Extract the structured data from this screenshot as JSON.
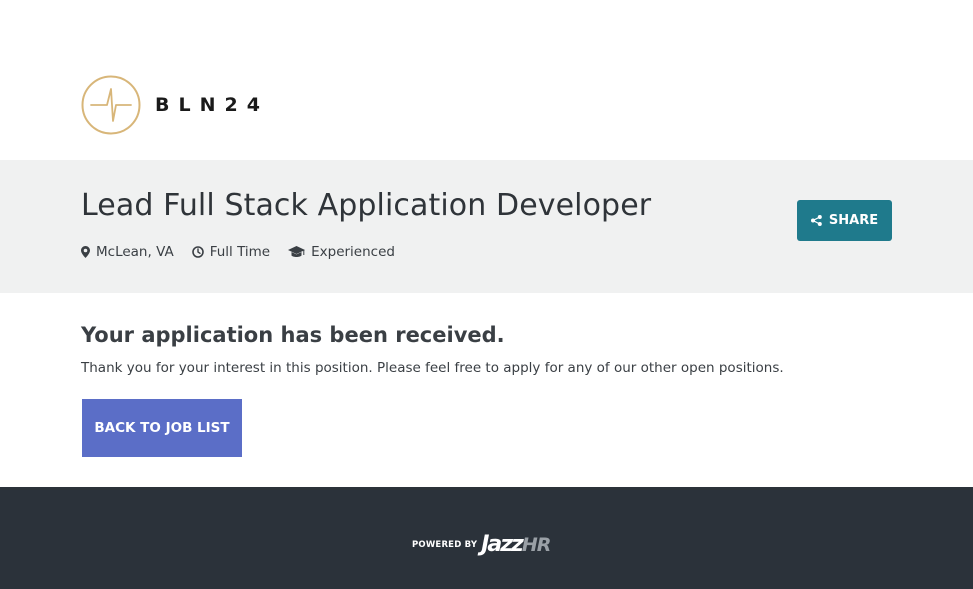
{
  "brand": {
    "name": "BLN24",
    "logo_icon": "spark-circle-logo",
    "accent_color": "#d8b679"
  },
  "job": {
    "title": "Lead Full Stack Application Developer",
    "location": "McLean, VA",
    "type": "Full Time",
    "experience": "Experienced",
    "location_icon": "map-marker-icon",
    "type_icon": "clock-icon",
    "experience_icon": "graduation-cap-icon"
  },
  "share": {
    "label": "SHARE",
    "icon": "share-icon",
    "color": "#1f7a8c"
  },
  "confirmation": {
    "heading": "Your application has been received.",
    "message": "Thank you for your interest in this position. Please feel free to apply for any of our other open positions.",
    "back_label": "BACK TO JOB LIST",
    "back_color": "#5b6ec7"
  },
  "footer": {
    "powered_by": "POWERED BY",
    "jazz": "Jazz",
    "hr": "HR",
    "background": "#2b323a"
  }
}
